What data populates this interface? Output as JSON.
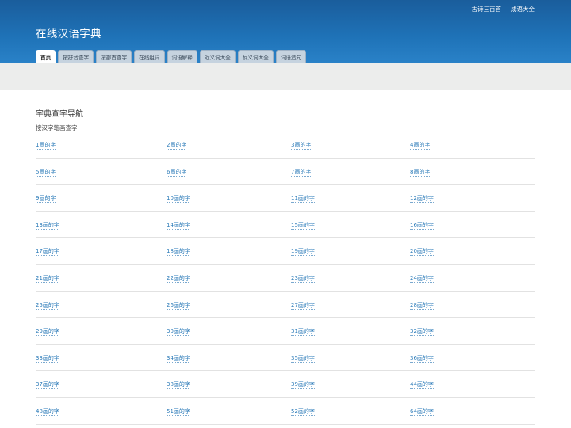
{
  "header": {
    "top_links": [
      "古诗三百首",
      "成语大全"
    ],
    "site_title": "在线汉语字典",
    "tabs": [
      "首页",
      "按拼音查字",
      "按部首查字",
      "在线组词",
      "词语解释",
      "近义词大全",
      "反义词大全",
      "词语造句"
    ],
    "active_tab": 0
  },
  "main": {
    "section_title": "字典查字导航",
    "sub_title": "按汉字笔画查字",
    "stroke_links": [
      [
        "1画的字",
        "2画的字",
        "3画的字",
        "4画的字"
      ],
      [
        "5画的字",
        "6画的字",
        "7画的字",
        "8画的字"
      ],
      [
        "9画的字",
        "10画的字",
        "11画的字",
        "12画的字"
      ],
      [
        "13画的字",
        "14画的字",
        "15画的字",
        "16画的字"
      ],
      [
        "17画的字",
        "18画的字",
        "19画的字",
        "20画的字"
      ],
      [
        "21画的字",
        "22画的字",
        "23画的字",
        "24画的字"
      ],
      [
        "25画的字",
        "26画的字",
        "27画的字",
        "28画的字"
      ],
      [
        "29画的字",
        "30画的字",
        "31画的字",
        "32画的字"
      ],
      [
        "33画的字",
        "34画的字",
        "35画的字",
        "36画的字"
      ],
      [
        "37画的字",
        "38画的字",
        "39画的字",
        "44画的字"
      ],
      [
        "48画的字",
        "51画的字",
        "52画的字",
        "64画的字"
      ]
    ]
  },
  "colors": {
    "header_blue": "#1f73b8",
    "link_blue": "#2a7ab8",
    "band_gray": "#ecedec"
  }
}
